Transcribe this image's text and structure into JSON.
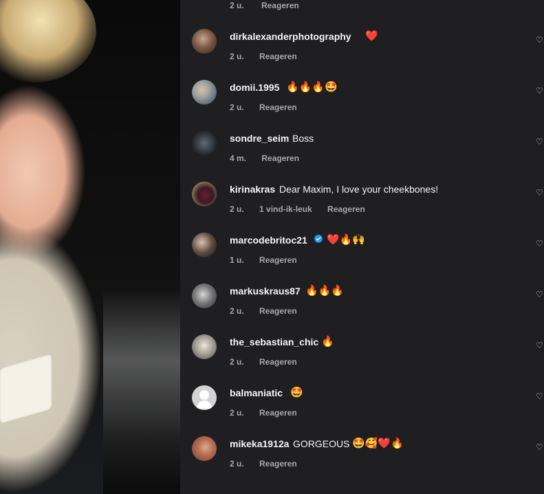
{
  "top_partial": {
    "time": "2 u.",
    "reply": "Reageren"
  },
  "comments": [
    {
      "username": "dirkalexanderphotography",
      "text": "",
      "emojis": "❤️",
      "time": "2 u.",
      "likes": "",
      "reply": "Reageren"
    },
    {
      "username": "domii.1995",
      "text": "",
      "emojis": "🔥🔥🔥🤩",
      "time": "2 u.",
      "likes": "",
      "reply": "Reageren"
    },
    {
      "username": "sondre_seim",
      "text": "Boss",
      "emojis": "",
      "time": "4 m.",
      "likes": "",
      "reply": "Reageren"
    },
    {
      "username": "kirinakras",
      "text": "Dear Maxim, I love your cheekbones!",
      "emojis": "",
      "time": "2 u.",
      "likes": "1 vind-ik-leuk",
      "reply": "Reageren"
    },
    {
      "username": "marcodebritoc21",
      "text": "",
      "emojis": "❤️🔥🙌",
      "time": "1 u.",
      "likes": "",
      "reply": "Reageren",
      "verified": true
    },
    {
      "username": "markuskraus87",
      "text": "",
      "emojis": "🔥🔥🔥",
      "time": "2 u.",
      "likes": "",
      "reply": "Reageren"
    },
    {
      "username": "the_sebastian_chic",
      "text": "",
      "emojis": "🔥",
      "time": "2 u.",
      "likes": "",
      "reply": "Reageren"
    },
    {
      "username": "balmaniatic",
      "text": "",
      "emojis": "🤩",
      "time": "2 u.",
      "likes": "",
      "reply": "Reageren"
    },
    {
      "username": "mikeka1912a",
      "text": "GORGEOUS",
      "emojis": "🤩🥰❤️🔥",
      "time": "2 u.",
      "likes": "",
      "reply": "Reageren"
    }
  ],
  "icons": {
    "like": "heart-outline-icon",
    "verified": "verified-badge-icon",
    "default_avatar": "default-avatar-icon"
  },
  "colors": {
    "panel_bg": "#1f1f22",
    "text_primary": "#f5f5f5",
    "text_secondary": "#a8a8a8",
    "verified": "#1d9bf0"
  }
}
